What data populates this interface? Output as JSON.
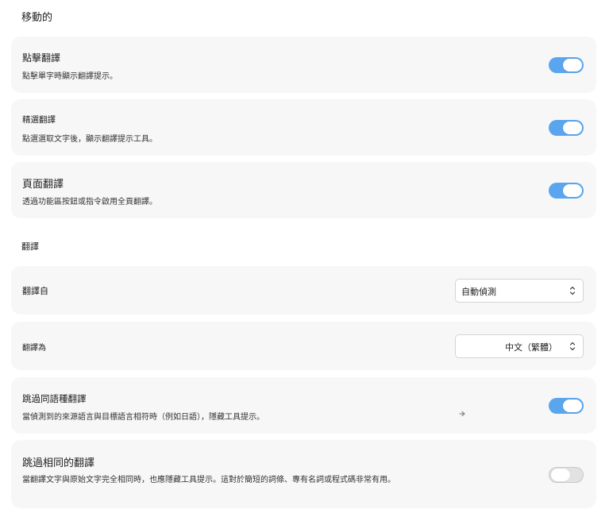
{
  "sections": {
    "mobile_title": "移動的",
    "translate_title": "翻譯"
  },
  "settings": {
    "tap_translate": {
      "title": "點擊翻譯",
      "desc": "點擊單字時顯示翻譯提示。",
      "enabled": true
    },
    "selection_translate": {
      "title": "精選翻譯",
      "desc": "點選選取文字後，顯示翻譯提示工具。",
      "enabled": true
    },
    "page_translate": {
      "title": "頁面翻譯",
      "desc": "透過功能區按鈕或指令啟用全頁翻譯。",
      "enabled": true
    },
    "translate_from": {
      "label": "翻譯自",
      "value": "自動偵測"
    },
    "translate_to": {
      "label": "翻譯為",
      "value": "中文（繁體）"
    },
    "skip_same_language": {
      "title": "跳過同語種翻譯",
      "desc": "當偵測到的來源語言與目標語言相符時（例如日語），隱藏工具提示。",
      "enabled": true
    },
    "skip_identical": {
      "title": "跳過相同的翻譯",
      "desc": "當翻譯文字與原始文字完全相同時，也應隱藏工具提示。這對於簡短的詞條、專有名詞或程式碼非常有用。",
      "enabled": false
    }
  },
  "icons": {
    "select_chevron": "chevron-up-down-icon",
    "cursor": "mouse-pointer-icon"
  },
  "colors": {
    "toggle_on": "#5aa6ee",
    "toggle_off": "#e2e2e4",
    "card_bg": "#f7f7f7"
  }
}
